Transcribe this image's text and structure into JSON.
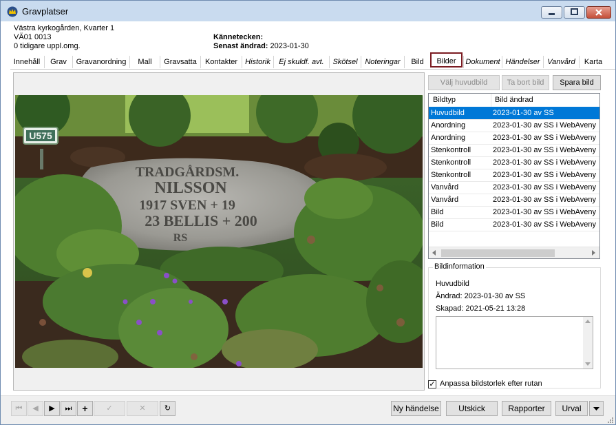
{
  "window": {
    "title": "Gravplatser"
  },
  "header": {
    "location": "Västra kyrkogården, Kvarter 1",
    "code": "VÄ01 0013",
    "previous": "0 tidigare uppl.omg.",
    "identifier_label": "Kännetecken:",
    "changed_label": "Senast ändrad:",
    "changed_value": "2023-01-30"
  },
  "tabs": [
    {
      "label": "Innehåll"
    },
    {
      "label": "Grav"
    },
    {
      "label": "Gravanordning"
    },
    {
      "label": "Mall"
    },
    {
      "label": "Gravsatta"
    },
    {
      "label": "Kontakter"
    },
    {
      "label": "Historik"
    },
    {
      "label": "Ej skuldf. avt."
    },
    {
      "label": "Skötsel"
    },
    {
      "label": "Noteringar"
    },
    {
      "label": "Bild"
    },
    {
      "label": "Bilder"
    },
    {
      "label": "Dokument"
    },
    {
      "label": "Händelser"
    },
    {
      "label": "Vanvård"
    },
    {
      "label": "Karta"
    }
  ],
  "image_buttons": {
    "choose_main": "Välj huvudbild",
    "remove": "Ta bort bild",
    "save": "Spara bild"
  },
  "image_list": {
    "headers": [
      "Bildtyp",
      "Bild ändrad"
    ],
    "rows": [
      {
        "type": "Huvudbild",
        "changed": "2023-01-30 av SS"
      },
      {
        "type": "Anordning",
        "changed": "2023-01-30 av SS i WebAveny"
      },
      {
        "type": "Anordning",
        "changed": "2023-01-30 av SS i WebAveny"
      },
      {
        "type": "Stenkontroll",
        "changed": "2023-01-30 av SS i WebAveny"
      },
      {
        "type": "Stenkontroll",
        "changed": "2023-01-30 av SS i WebAveny"
      },
      {
        "type": "Stenkontroll",
        "changed": "2023-01-30 av SS i WebAveny"
      },
      {
        "type": "Vanvård",
        "changed": "2023-01-30 av SS i WebAveny"
      },
      {
        "type": "Vanvård",
        "changed": "2023-01-30 av SS i WebAveny"
      },
      {
        "type": "Bild",
        "changed": "2023-01-30 av SS i WebAveny"
      },
      {
        "type": "Bild",
        "changed": "2023-01-30 av SS i WebAveny"
      }
    ]
  },
  "bildinfo": {
    "label": "Bildinformation",
    "type": "Huvudbild",
    "changed": "Ändrad: 2023-01-30 av SS",
    "created": "Skapad: 2021-05-21 13:28"
  },
  "fit_checkbox": {
    "label": "Anpassa bildstorlek efter rutan",
    "checked": true
  },
  "bottom_buttons": {
    "new_event": "Ny händelse",
    "print": "Utskick",
    "reports": "Rapporter",
    "selection": "Urval"
  },
  "photo": {
    "marker_text": "U575",
    "stone_lines": [
      "TRADGÅRDSM.",
      "NILSSON",
      "1917 SVEN + 19",
      "23 BELLIS + 200",
      "RS"
    ]
  },
  "colors": {
    "accent_tab": "#7b1c22",
    "selection": "#0078d7"
  }
}
